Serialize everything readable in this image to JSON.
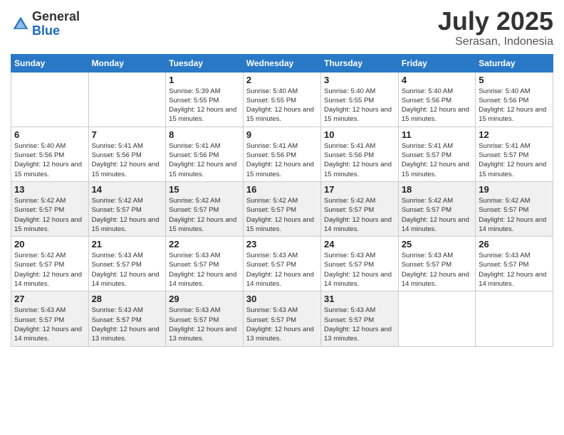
{
  "header": {
    "logo_general": "General",
    "logo_blue": "Blue",
    "title": "July 2025",
    "location": "Serasan, Indonesia"
  },
  "days_of_week": [
    "Sunday",
    "Monday",
    "Tuesday",
    "Wednesday",
    "Thursday",
    "Friday",
    "Saturday"
  ],
  "weeks": [
    [
      {
        "day": "",
        "sunrise": "",
        "sunset": "",
        "daylight": ""
      },
      {
        "day": "",
        "sunrise": "",
        "sunset": "",
        "daylight": ""
      },
      {
        "day": "1",
        "sunrise": "Sunrise: 5:39 AM",
        "sunset": "Sunset: 5:55 PM",
        "daylight": "Daylight: 12 hours and 15 minutes."
      },
      {
        "day": "2",
        "sunrise": "Sunrise: 5:40 AM",
        "sunset": "Sunset: 5:55 PM",
        "daylight": "Daylight: 12 hours and 15 minutes."
      },
      {
        "day": "3",
        "sunrise": "Sunrise: 5:40 AM",
        "sunset": "Sunset: 5:55 PM",
        "daylight": "Daylight: 12 hours and 15 minutes."
      },
      {
        "day": "4",
        "sunrise": "Sunrise: 5:40 AM",
        "sunset": "Sunset: 5:56 PM",
        "daylight": "Daylight: 12 hours and 15 minutes."
      },
      {
        "day": "5",
        "sunrise": "Sunrise: 5:40 AM",
        "sunset": "Sunset: 5:56 PM",
        "daylight": "Daylight: 12 hours and 15 minutes."
      }
    ],
    [
      {
        "day": "6",
        "sunrise": "Sunrise: 5:40 AM",
        "sunset": "Sunset: 5:56 PM",
        "daylight": "Daylight: 12 hours and 15 minutes."
      },
      {
        "day": "7",
        "sunrise": "Sunrise: 5:41 AM",
        "sunset": "Sunset: 5:56 PM",
        "daylight": "Daylight: 12 hours and 15 minutes."
      },
      {
        "day": "8",
        "sunrise": "Sunrise: 5:41 AM",
        "sunset": "Sunset: 5:56 PM",
        "daylight": "Daylight: 12 hours and 15 minutes."
      },
      {
        "day": "9",
        "sunrise": "Sunrise: 5:41 AM",
        "sunset": "Sunset: 5:56 PM",
        "daylight": "Daylight: 12 hours and 15 minutes."
      },
      {
        "day": "10",
        "sunrise": "Sunrise: 5:41 AM",
        "sunset": "Sunset: 5:56 PM",
        "daylight": "Daylight: 12 hours and 15 minutes."
      },
      {
        "day": "11",
        "sunrise": "Sunrise: 5:41 AM",
        "sunset": "Sunset: 5:57 PM",
        "daylight": "Daylight: 12 hours and 15 minutes."
      },
      {
        "day": "12",
        "sunrise": "Sunrise: 5:41 AM",
        "sunset": "Sunset: 5:57 PM",
        "daylight": "Daylight: 12 hours and 15 minutes."
      }
    ],
    [
      {
        "day": "13",
        "sunrise": "Sunrise: 5:42 AM",
        "sunset": "Sunset: 5:57 PM",
        "daylight": "Daylight: 12 hours and 15 minutes."
      },
      {
        "day": "14",
        "sunrise": "Sunrise: 5:42 AM",
        "sunset": "Sunset: 5:57 PM",
        "daylight": "Daylight: 12 hours and 15 minutes."
      },
      {
        "day": "15",
        "sunrise": "Sunrise: 5:42 AM",
        "sunset": "Sunset: 5:57 PM",
        "daylight": "Daylight: 12 hours and 15 minutes."
      },
      {
        "day": "16",
        "sunrise": "Sunrise: 5:42 AM",
        "sunset": "Sunset: 5:57 PM",
        "daylight": "Daylight: 12 hours and 15 minutes."
      },
      {
        "day": "17",
        "sunrise": "Sunrise: 5:42 AM",
        "sunset": "Sunset: 5:57 PM",
        "daylight": "Daylight: 12 hours and 14 minutes."
      },
      {
        "day": "18",
        "sunrise": "Sunrise: 5:42 AM",
        "sunset": "Sunset: 5:57 PM",
        "daylight": "Daylight: 12 hours and 14 minutes."
      },
      {
        "day": "19",
        "sunrise": "Sunrise: 5:42 AM",
        "sunset": "Sunset: 5:57 PM",
        "daylight": "Daylight: 12 hours and 14 minutes."
      }
    ],
    [
      {
        "day": "20",
        "sunrise": "Sunrise: 5:42 AM",
        "sunset": "Sunset: 5:57 PM",
        "daylight": "Daylight: 12 hours and 14 minutes."
      },
      {
        "day": "21",
        "sunrise": "Sunrise: 5:43 AM",
        "sunset": "Sunset: 5:57 PM",
        "daylight": "Daylight: 12 hours and 14 minutes."
      },
      {
        "day": "22",
        "sunrise": "Sunrise: 5:43 AM",
        "sunset": "Sunset: 5:57 PM",
        "daylight": "Daylight: 12 hours and 14 minutes."
      },
      {
        "day": "23",
        "sunrise": "Sunrise: 5:43 AM",
        "sunset": "Sunset: 5:57 PM",
        "daylight": "Daylight: 12 hours and 14 minutes."
      },
      {
        "day": "24",
        "sunrise": "Sunrise: 5:43 AM",
        "sunset": "Sunset: 5:57 PM",
        "daylight": "Daylight: 12 hours and 14 minutes."
      },
      {
        "day": "25",
        "sunrise": "Sunrise: 5:43 AM",
        "sunset": "Sunset: 5:57 PM",
        "daylight": "Daylight: 12 hours and 14 minutes."
      },
      {
        "day": "26",
        "sunrise": "Sunrise: 5:43 AM",
        "sunset": "Sunset: 5:57 PM",
        "daylight": "Daylight: 12 hours and 14 minutes."
      }
    ],
    [
      {
        "day": "27",
        "sunrise": "Sunrise: 5:43 AM",
        "sunset": "Sunset: 5:57 PM",
        "daylight": "Daylight: 12 hours and 14 minutes."
      },
      {
        "day": "28",
        "sunrise": "Sunrise: 5:43 AM",
        "sunset": "Sunset: 5:57 PM",
        "daylight": "Daylight: 12 hours and 13 minutes."
      },
      {
        "day": "29",
        "sunrise": "Sunrise: 5:43 AM",
        "sunset": "Sunset: 5:57 PM",
        "daylight": "Daylight: 12 hours and 13 minutes."
      },
      {
        "day": "30",
        "sunrise": "Sunrise: 5:43 AM",
        "sunset": "Sunset: 5:57 PM",
        "daylight": "Daylight: 12 hours and 13 minutes."
      },
      {
        "day": "31",
        "sunrise": "Sunrise: 5:43 AM",
        "sunset": "Sunset: 5:57 PM",
        "daylight": "Daylight: 12 hours and 13 minutes."
      },
      {
        "day": "",
        "sunrise": "",
        "sunset": "",
        "daylight": ""
      },
      {
        "day": "",
        "sunrise": "",
        "sunset": "",
        "daylight": ""
      }
    ]
  ]
}
